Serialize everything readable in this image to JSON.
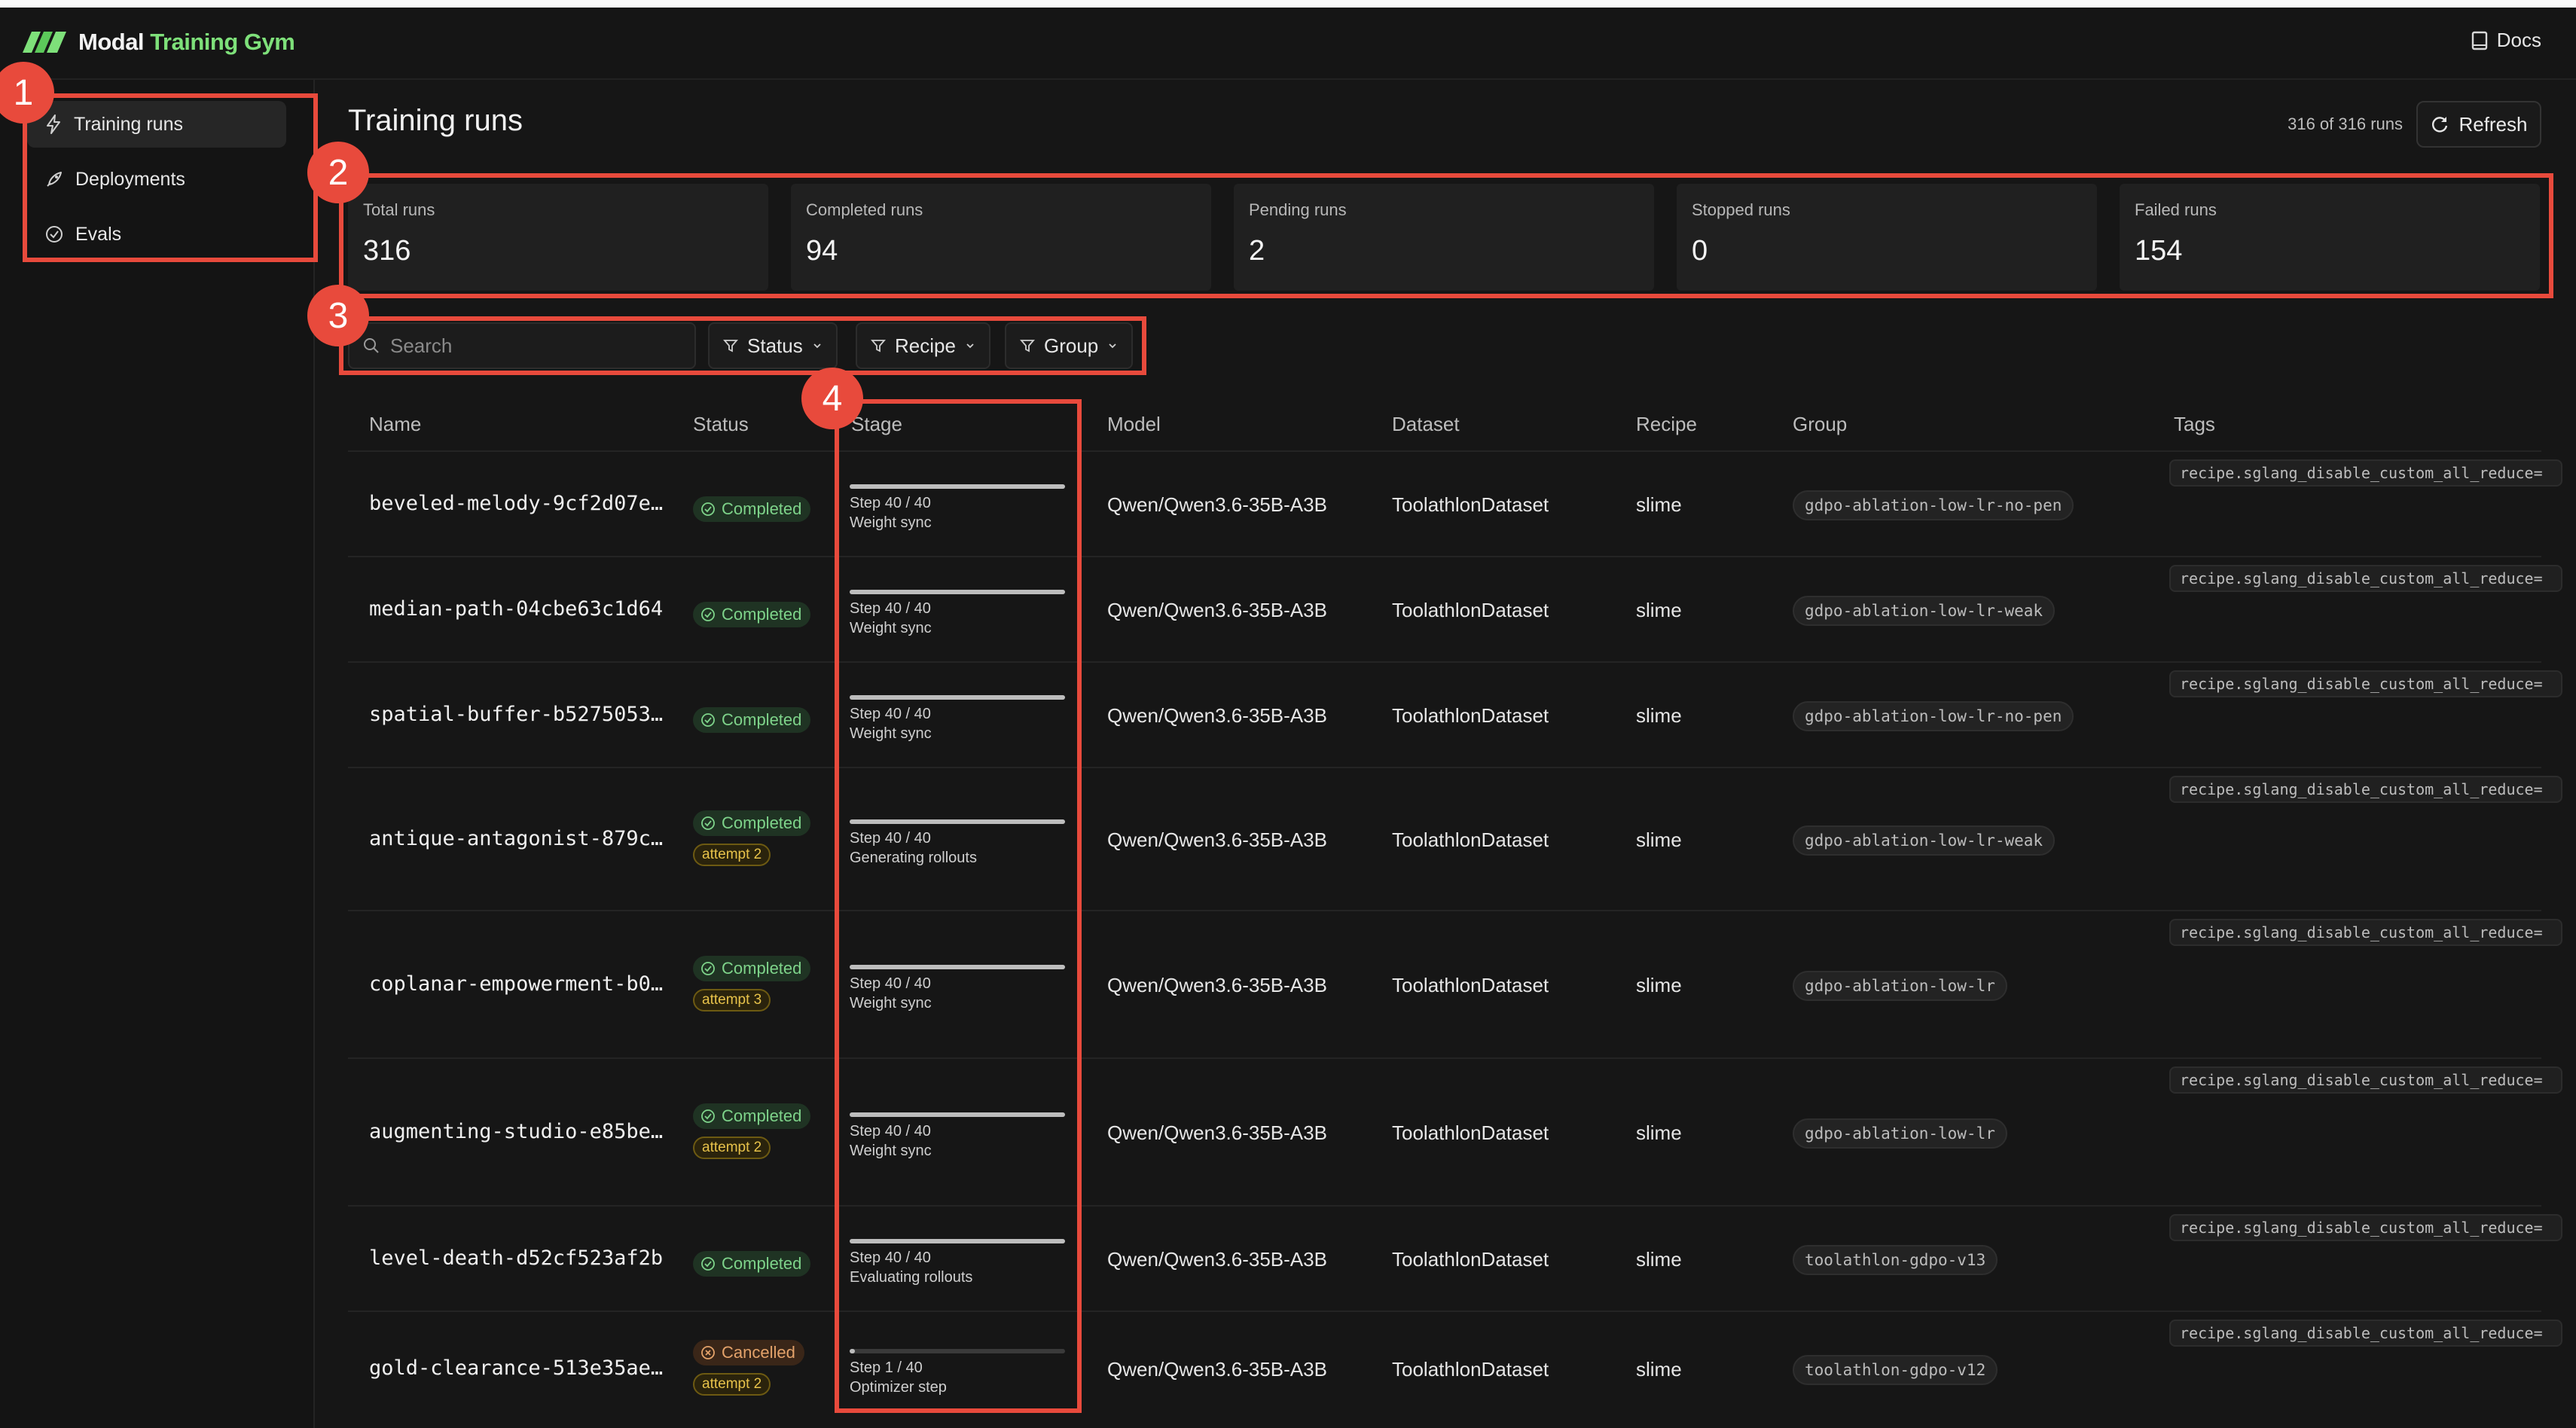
{
  "app": {
    "brand_word1": "Modal",
    "brand_word2": "Training Gym",
    "docs_label": "Docs",
    "brand_color": "#7ee07a"
  },
  "sidebar": {
    "items": [
      {
        "label": "Training runs",
        "icon": "bolt-icon",
        "active": true
      },
      {
        "label": "Deployments",
        "icon": "rocket-icon",
        "active": false
      },
      {
        "label": "Evals",
        "icon": "check-circle-icon",
        "active": false
      }
    ]
  },
  "page": {
    "title": "Training runs",
    "run_count": "316 of 316 runs",
    "refresh_label": "Refresh"
  },
  "stats": [
    {
      "label": "Total runs",
      "value": "316"
    },
    {
      "label": "Completed runs",
      "value": "94"
    },
    {
      "label": "Pending runs",
      "value": "2"
    },
    {
      "label": "Stopped runs",
      "value": "0"
    },
    {
      "label": "Failed runs",
      "value": "154"
    }
  ],
  "filters": {
    "search_placeholder": "Search",
    "status_label": "Status",
    "recipe_label": "Recipe",
    "group_label": "Group"
  },
  "table": {
    "headers": {
      "name": "Name",
      "status": "Status",
      "stage": "Stage",
      "model": "Model",
      "dataset": "Dataset",
      "recipe": "Recipe",
      "group": "Group",
      "tags": "Tags"
    },
    "rows": [
      {
        "name": "beveled-melody-9cf2d07e…",
        "status": "Completed",
        "attempt": "",
        "step": "Step 40 / 40",
        "progress": 1.0,
        "stage": "Weight sync",
        "model": "Qwen/Qwen3.6-35B-A3B",
        "dataset": "ToolathlonDataset",
        "recipe": "slime",
        "group": "gdpo-ablation-low-lr-no-pen",
        "tag": "recipe.sglang_disable_custom_all_reduce="
      },
      {
        "name": "median-path-04cbe63c1d64",
        "status": "Completed",
        "attempt": "",
        "step": "Step 40 / 40",
        "progress": 1.0,
        "stage": "Weight sync",
        "model": "Qwen/Qwen3.6-35B-A3B",
        "dataset": "ToolathlonDataset",
        "recipe": "slime",
        "group": "gdpo-ablation-low-lr-weak",
        "tag": "recipe.sglang_disable_custom_all_reduce="
      },
      {
        "name": "spatial-buffer-b5275053…",
        "status": "Completed",
        "attempt": "",
        "step": "Step 40 / 40",
        "progress": 1.0,
        "stage": "Weight sync",
        "model": "Qwen/Qwen3.6-35B-A3B",
        "dataset": "ToolathlonDataset",
        "recipe": "slime",
        "group": "gdpo-ablation-low-lr-no-pen",
        "tag": "recipe.sglang_disable_custom_all_reduce="
      },
      {
        "name": "antique-antagonist-879c…",
        "status": "Completed",
        "attempt": "attempt 2",
        "step": "Step 40 / 40",
        "progress": 1.0,
        "stage": "Generating rollouts",
        "model": "Qwen/Qwen3.6-35B-A3B",
        "dataset": "ToolathlonDataset",
        "recipe": "slime",
        "group": "gdpo-ablation-low-lr-weak",
        "tag": "recipe.sglang_disable_custom_all_reduce="
      },
      {
        "name": "coplanar-empowerment-b0…",
        "status": "Completed",
        "attempt": "attempt 3",
        "step": "Step 40 / 40",
        "progress": 1.0,
        "stage": "Weight sync",
        "model": "Qwen/Qwen3.6-35B-A3B",
        "dataset": "ToolathlonDataset",
        "recipe": "slime",
        "group": "gdpo-ablation-low-lr",
        "tag": "recipe.sglang_disable_custom_all_reduce="
      },
      {
        "name": "augmenting-studio-e85be…",
        "status": "Completed",
        "attempt": "attempt 2",
        "step": "Step 40 / 40",
        "progress": 1.0,
        "stage": "Weight sync",
        "model": "Qwen/Qwen3.6-35B-A3B",
        "dataset": "ToolathlonDataset",
        "recipe": "slime",
        "group": "gdpo-ablation-low-lr",
        "tag": "recipe.sglang_disable_custom_all_reduce="
      },
      {
        "name": "level-death-d52cf523af2b",
        "status": "Completed",
        "attempt": "",
        "step": "Step 40 / 40",
        "progress": 1.0,
        "stage": "Evaluating rollouts",
        "model": "Qwen/Qwen3.6-35B-A3B",
        "dataset": "ToolathlonDataset",
        "recipe": "slime",
        "group": "toolathlon-gdpo-v13",
        "tag": "recipe.sglang_disable_custom_all_reduce="
      },
      {
        "name": "gold-clearance-513e35ae…",
        "status": "Cancelled",
        "attempt": "attempt 2",
        "step": "Step 1 / 40",
        "progress": 0.025,
        "stage": "Optimizer step",
        "model": "Qwen/Qwen3.6-35B-A3B",
        "dataset": "ToolathlonDataset",
        "recipe": "slime",
        "group": "toolathlon-gdpo-v12",
        "tag": "recipe.sglang_disable_custom_all_reduce="
      }
    ]
  },
  "annotations": [
    "1",
    "2",
    "3",
    "4"
  ]
}
